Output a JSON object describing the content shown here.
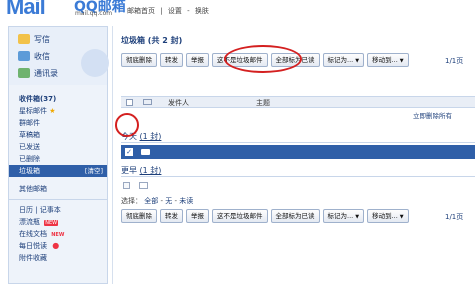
{
  "header": {
    "logo_text": "Mail",
    "logo_cn": "QQ邮箱",
    "logo_url": "mail.qq.com",
    "links": [
      "邮箱首页",
      "|",
      "设置",
      "-",
      "换肤"
    ]
  },
  "sidebar": {
    "quick": [
      {
        "label": "写信",
        "icon": "pencil-icon"
      },
      {
        "label": "收信",
        "icon": "inbox-icon"
      },
      {
        "label": "通讯录",
        "icon": "contacts-icon"
      }
    ],
    "folders": [
      {
        "label": "收件箱(37)",
        "bold": true
      },
      {
        "label": "星标邮件",
        "star": "★"
      },
      {
        "label": "群邮件"
      },
      {
        "label": "草稿箱"
      },
      {
        "label": "已发送"
      },
      {
        "label": "已删除"
      },
      {
        "label": "垃圾箱",
        "active": true,
        "extra": "[清空]"
      }
    ],
    "other_folders": "其他邮箱",
    "apps": [
      {
        "label": "日历 | 记事本"
      },
      {
        "label": "漂流瓶",
        "badge": "NEW"
      },
      {
        "label": "在线文档",
        "new_text": "NEW"
      },
      {
        "label": "每日悦读",
        "dot": "●"
      },
      {
        "label": "附件收藏"
      }
    ]
  },
  "main": {
    "title": "垃圾箱 (共 2 封)",
    "toolbar": [
      {
        "label": "彻底删除"
      },
      {
        "label": "转发"
      },
      {
        "label": "举报"
      },
      {
        "label": "这不是垃圾邮件"
      },
      {
        "label": "全部标为已读"
      },
      {
        "label": "标记为...",
        "dropdown": true
      },
      {
        "label": "移动到...",
        "dropdown": true
      }
    ],
    "pager": "1/1页",
    "columns": {
      "sender": "发件人",
      "subject": "主题"
    },
    "notice": "立即删除所有",
    "groups": [
      {
        "label": "今天",
        "count": "(1 封)"
      },
      {
        "label": "更早",
        "count": "(1 封)"
      }
    ],
    "select_line": {
      "prefix": "选择：",
      "all": "全部",
      "none": "无",
      "unread": "未读",
      "dash": "-"
    }
  }
}
